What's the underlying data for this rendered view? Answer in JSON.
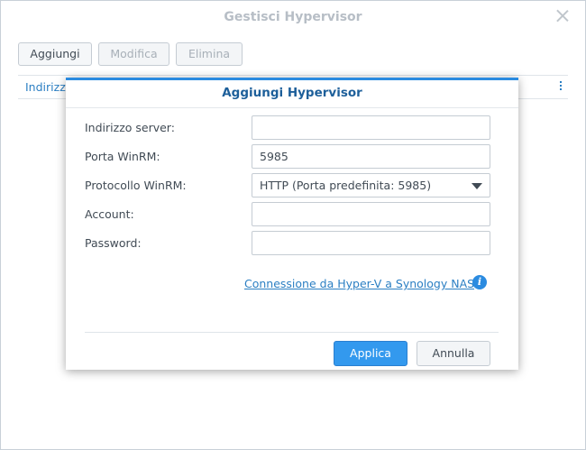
{
  "window": {
    "title": "Gestisci Hypervisor"
  },
  "toolbar": {
    "add_label": "Aggiungi",
    "edit_label": "Modifica",
    "delete_label": "Elimina"
  },
  "grid": {
    "first_column_label": "Indirizzo"
  },
  "dialog": {
    "title": "Aggiungi Hypervisor",
    "fields": {
      "server_address": {
        "label": "Indirizzo server:",
        "value": ""
      },
      "winrm_port": {
        "label": "Porta WinRM:",
        "value": "5985"
      },
      "winrm_protocol": {
        "label": "Protocollo WinRM:",
        "value": "HTTP (Porta predefinita: 5985)"
      },
      "account": {
        "label": "Account:",
        "value": ""
      },
      "password": {
        "label": "Password:",
        "value": ""
      }
    },
    "help_link": "Connessione da Hyper-V a Synology NAS",
    "apply_label": "Applica",
    "cancel_label": "Annulla"
  },
  "colors": {
    "accent": "#2b8be0",
    "link": "#2b7fc3",
    "primary_button": "#3399ee"
  },
  "icons": {
    "close": "close-icon",
    "grid_menu": "vertical-dots-icon",
    "select": "caret-down-icon",
    "info": "info-icon"
  }
}
